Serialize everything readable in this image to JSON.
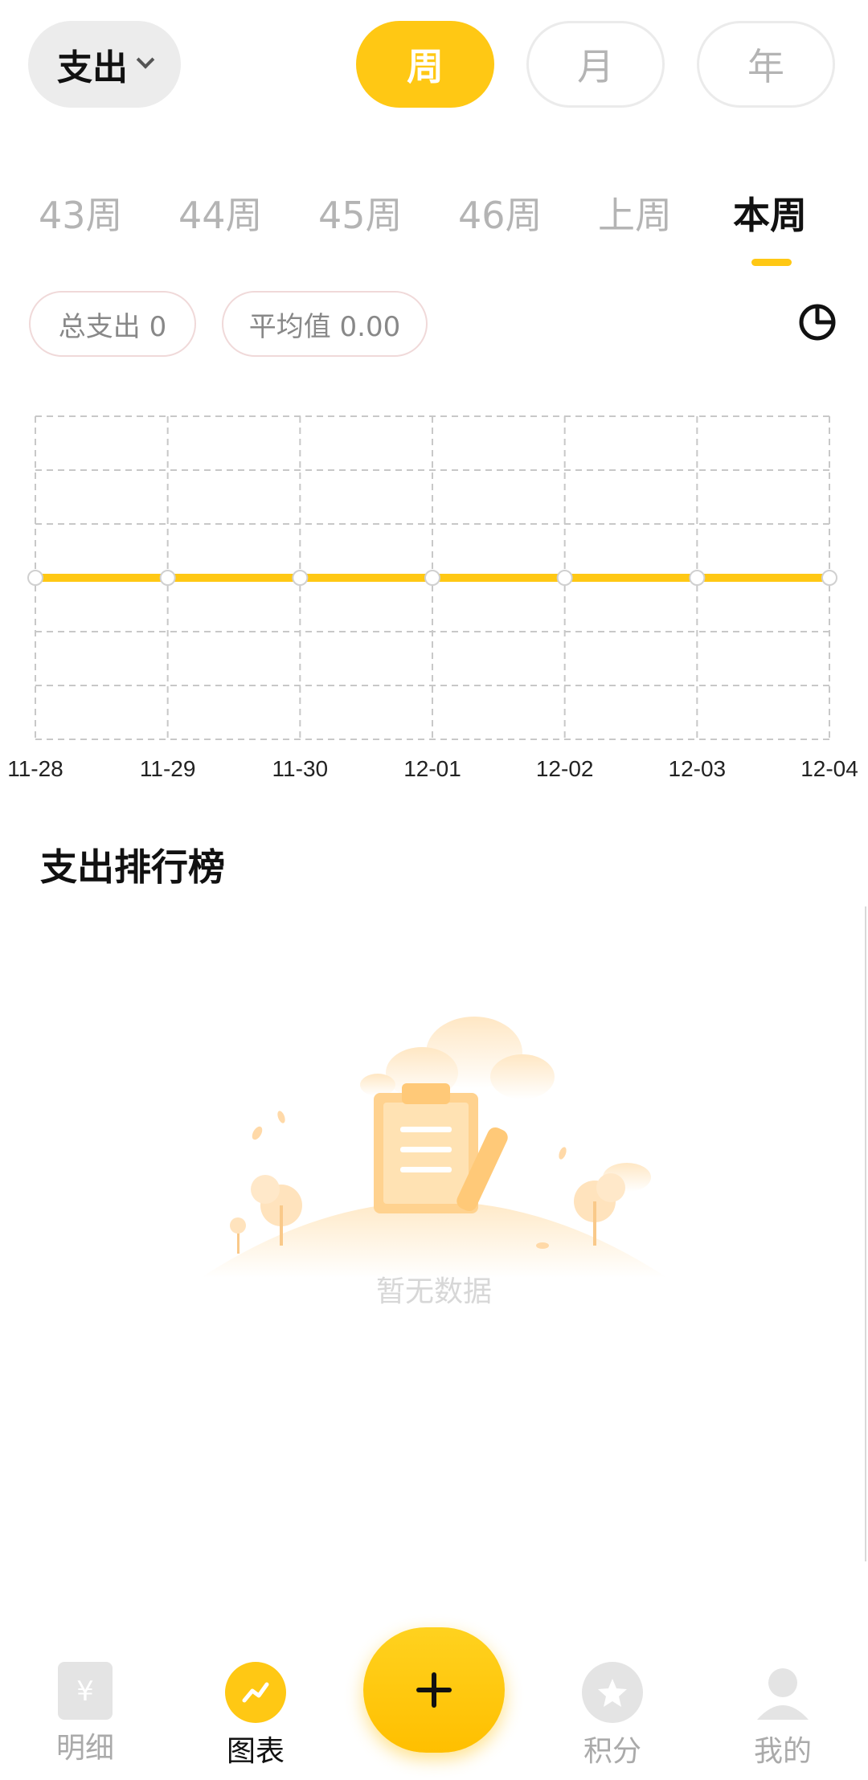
{
  "header": {
    "type_dropdown": "支出",
    "period_tabs": [
      {
        "label": "周",
        "active": true
      },
      {
        "label": "月",
        "active": false
      },
      {
        "label": "年",
        "active": false
      }
    ]
  },
  "week_tabs": [
    {
      "label": "43周",
      "active": false
    },
    {
      "label": "44周",
      "active": false
    },
    {
      "label": "45周",
      "active": false
    },
    {
      "label": "46周",
      "active": false
    },
    {
      "label": "上周",
      "active": false
    },
    {
      "label": "本周",
      "active": true
    }
  ],
  "stats": {
    "total": "总支出 0",
    "average": "平均值 0.00"
  },
  "chart_data": {
    "type": "line",
    "x": [
      "11-28",
      "11-29",
      "11-30",
      "12-01",
      "12-02",
      "12-03",
      "12-04"
    ],
    "series": [
      {
        "values": [
          0,
          0,
          0,
          0,
          0,
          0,
          0
        ]
      }
    ],
    "grid": true,
    "title": "",
    "xlabel": "",
    "ylabel": ""
  },
  "ranking": {
    "title": "支出排行榜",
    "empty_text": "暂无数据"
  },
  "bottom_nav": {
    "items": [
      {
        "label": "明细",
        "icon": "ledger-icon",
        "active": false
      },
      {
        "label": "图表",
        "icon": "chart-icon",
        "active": true
      },
      {
        "label": "积分",
        "icon": "star-icon",
        "active": false
      },
      {
        "label": "我的",
        "icon": "profile-icon",
        "active": false
      }
    ],
    "add_icon": "plus-icon"
  },
  "colors": {
    "accent": "#ffc814",
    "muted_text": "#b4b4b4",
    "grid_line": "#c8c8c8"
  }
}
